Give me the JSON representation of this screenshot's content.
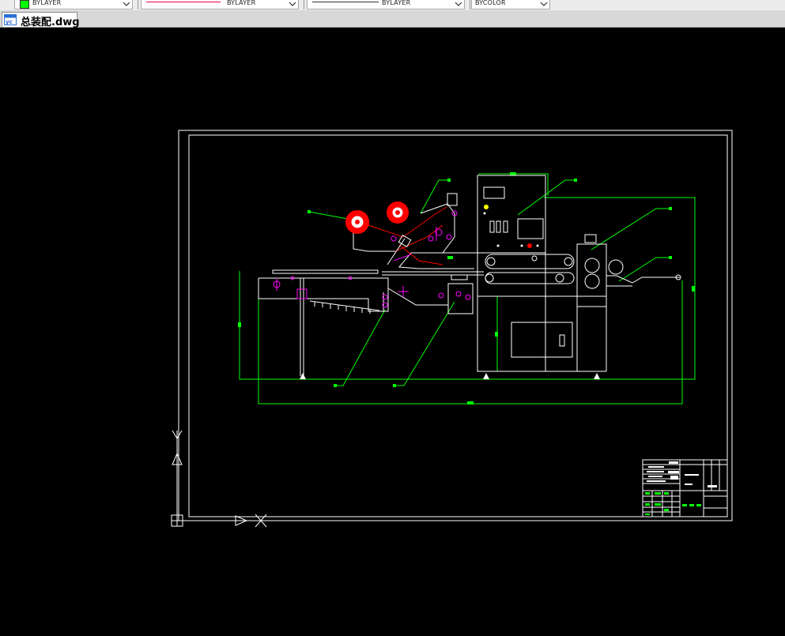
{
  "toolbar": {
    "color_control": {
      "value": "BYLAYER",
      "swatch": "#00ff00"
    },
    "linetype_control": {
      "value": "BYLAYER"
    },
    "lineweight_control": {
      "value": "BYLAYER"
    },
    "plotstyle_control": {
      "value": "BYCOLOR"
    }
  },
  "tabs": [
    {
      "label": "总装配.dwg",
      "icon": "dwg-file-icon",
      "active": true
    }
  ],
  "colors": {
    "background": "#000000",
    "frame": "#ffffff",
    "dimension": "#00ff00",
    "center": "#ff00ff",
    "highlight": "#ff0000",
    "marker": "#ffff00"
  }
}
